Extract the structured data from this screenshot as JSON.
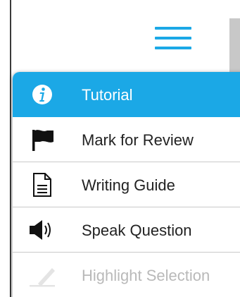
{
  "menu_button": {
    "icon": "hamburger-menu-icon",
    "color": "#1ba8e6"
  },
  "colors": {
    "accent": "#1ba8e6",
    "text": "#222222",
    "disabled_text": "#b9b9b9",
    "divider": "#c9c9c9"
  },
  "menu": {
    "items": [
      {
        "label": "Tutorial",
        "icon": "info-icon",
        "state": "active"
      },
      {
        "label": "Mark for Review",
        "icon": "flag-icon",
        "state": "normal"
      },
      {
        "label": "Writing Guide",
        "icon": "document-icon",
        "state": "normal"
      },
      {
        "label": "Speak Question",
        "icon": "speaker-icon",
        "state": "normal"
      },
      {
        "label": "Highlight Selection",
        "icon": "highlighter-icon",
        "state": "disabled"
      }
    ]
  }
}
